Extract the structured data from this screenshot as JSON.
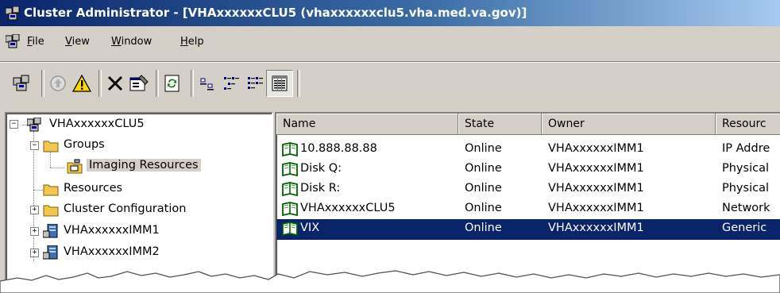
{
  "window": {
    "title": "Cluster Administrator - [VHAxxxxxxCLU5 (vhaxxxxxxclu5.vha.med.va.gov)]"
  },
  "menu": [
    {
      "label": "File",
      "accel": "F",
      "rest": "ile"
    },
    {
      "label": "View",
      "accel": "V",
      "rest": "iew"
    },
    {
      "label": "Window",
      "accel": "W",
      "rest": "indow"
    },
    {
      "label": "Help",
      "accel": "H",
      "rest": "elp"
    }
  ],
  "toolbar": {
    "icons": [
      "cluster-open-icon",
      "bring-online-icon",
      "take-offline-warning-icon",
      "delete-icon",
      "properties-icon",
      "refresh-icon",
      "large-icons-view-icon",
      "small-icons-view-icon",
      "list-view-icon",
      "details-view-icon"
    ]
  },
  "tree": {
    "root": "VHAxxxxxxCLU5",
    "groups": "Groups",
    "imaging": "Imaging Resources",
    "resources": "Resources",
    "config": "Cluster Configuration",
    "node1": "VHAxxxxxxIMM1",
    "node2": "VHAxxxxxxIMM2"
  },
  "list": {
    "columns": [
      "Name",
      "State",
      "Owner",
      "Resourc"
    ],
    "rows": [
      {
        "name": "10.888.88.88",
        "state": "Online",
        "owner": "VHAxxxxxxIMM1",
        "type": "IP Addre"
      },
      {
        "name": "Disk Q:",
        "state": "Online",
        "owner": "VHAxxxxxxIMM1",
        "type": "Physical"
      },
      {
        "name": "Disk R:",
        "state": "Online",
        "owner": "VHAxxxxxxIMM1",
        "type": "Physical"
      },
      {
        "name": "VHAxxxxxxCLU5",
        "state": "Online",
        "owner": "VHAxxxxxxIMM1",
        "type": "Network"
      },
      {
        "name": "VIX",
        "state": "Online",
        "owner": "VHAxxxxxxIMM1",
        "type": "Generic"
      }
    ],
    "selected_row": 4
  },
  "colors": {
    "title_dark": "#0a246a",
    "title_light": "#a6caf0",
    "face": "#d4d0c8",
    "selection": "#0a246a",
    "folder": "#f0c850"
  }
}
